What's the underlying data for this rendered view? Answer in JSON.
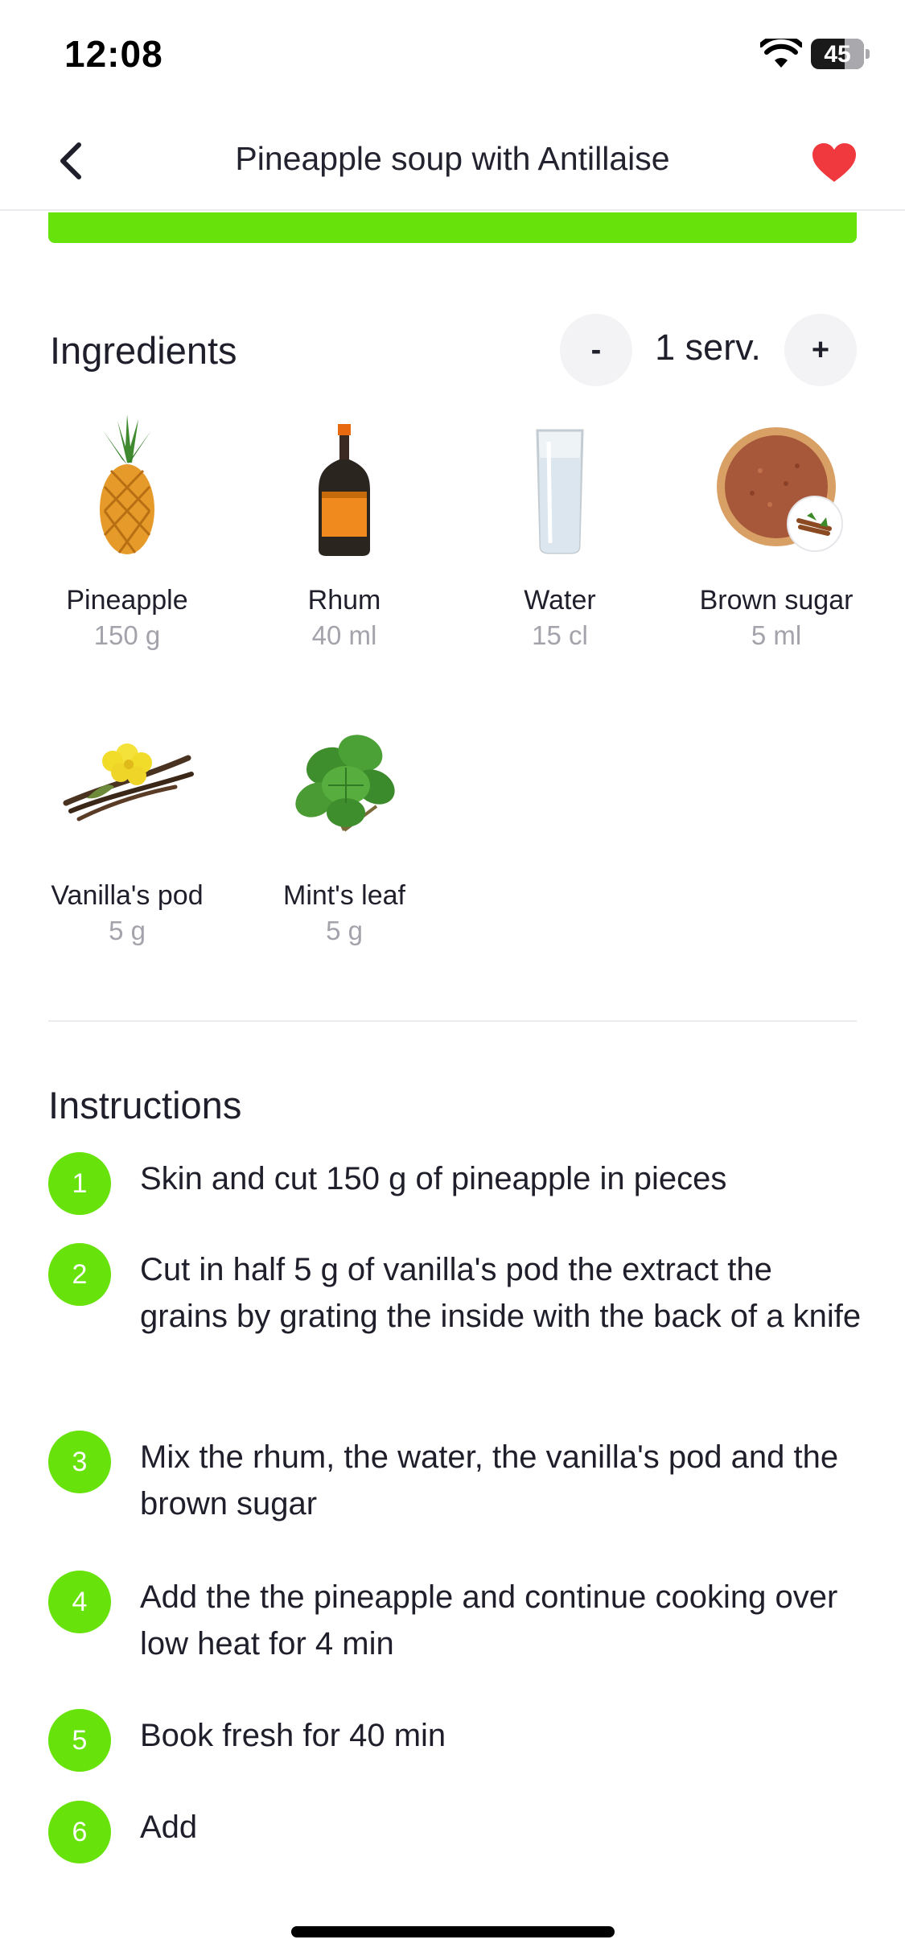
{
  "status_bar": {
    "time": "12:08",
    "battery": "45",
    "wifi_icon": "wifi-icon",
    "battery_icon": "battery-icon"
  },
  "nav": {
    "title": "Pineapple soup with Antillaise",
    "back_icon": "chevron-left-icon",
    "favorite_icon": "heart-icon",
    "favorite_color": "#f0393e"
  },
  "colors": {
    "accent": "#67e20b",
    "muted_text": "#a3a3ab"
  },
  "ingredients": {
    "title": "Ingredients",
    "servings": "1 serv.",
    "minus_label": "-",
    "plus_label": "+",
    "items": [
      {
        "name": "Pineapple",
        "qty": "150 g",
        "icon": "pineapple-icon"
      },
      {
        "name": "Rhum",
        "qty": "40 ml",
        "icon": "rum-bottle-icon"
      },
      {
        "name": "Water",
        "qty": "15 cl",
        "icon": "water-glass-icon"
      },
      {
        "name": "Brown sugar",
        "qty": "5 ml",
        "icon": "brown-sugar-bowl-icon"
      },
      {
        "name": "Vanilla's pod",
        "qty": "5 g",
        "icon": "vanilla-pod-icon"
      },
      {
        "name": "Mint's leaf",
        "qty": "5 g",
        "icon": "mint-leaf-icon"
      }
    ]
  },
  "instructions": {
    "title": "Instructions",
    "steps": [
      {
        "number": "1",
        "text": "Skin and cut 150 g of pineapple in pieces"
      },
      {
        "number": "2",
        "text": "Cut in half 5 g of vanilla's pod the extract the grains by grating the inside with the back of a knife"
      },
      {
        "number": "3",
        "text": "Mix the rhum, the water, the vanilla's pod and the brown sugar"
      },
      {
        "number": "4",
        "text": "Add the the pineapple and continue cooking over low heat for 4 min"
      },
      {
        "number": "5",
        "text": "Book fresh for 40 min"
      },
      {
        "number": "6",
        "text": "Add"
      }
    ]
  }
}
